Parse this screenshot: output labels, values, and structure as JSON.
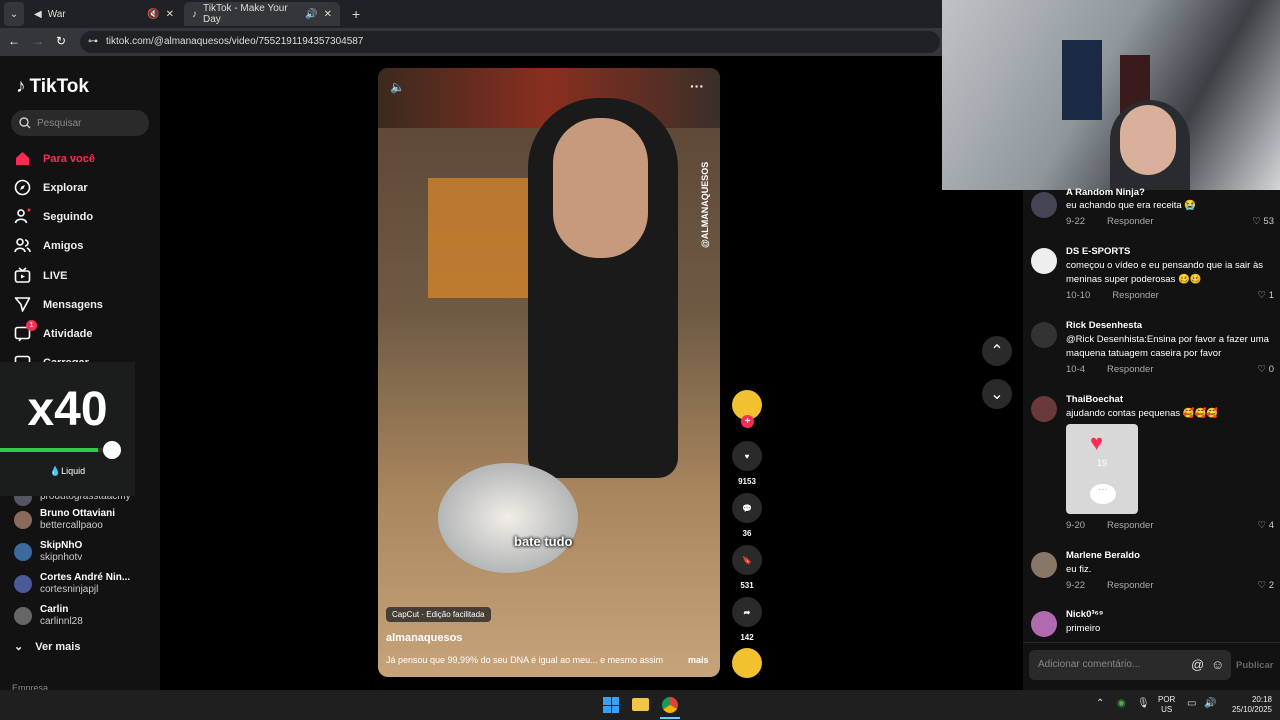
{
  "browser": {
    "tabs": [
      {
        "title": "War",
        "active": false
      },
      {
        "title": "TikTok - Make Your Day",
        "active": true
      }
    ],
    "url": "tiktok.com/@almanaquesos/video/7552191194357304587"
  },
  "sidebar": {
    "logo": "TikTok",
    "search_placeholder": "Pesquisar",
    "nav": [
      {
        "label": "Para você",
        "icon": "home-icon",
        "active": true
      },
      {
        "label": "Explorar",
        "icon": "compass-icon"
      },
      {
        "label": "Seguindo",
        "icon": "following-icon"
      },
      {
        "label": "Amigos",
        "icon": "friends-icon"
      },
      {
        "label": "LIVE",
        "icon": "live-icon"
      },
      {
        "label": "Mensagens",
        "icon": "send-icon"
      },
      {
        "label": "Atividade",
        "icon": "activity-icon",
        "badge": "1"
      },
      {
        "label": "Carregar",
        "icon": "upload-icon"
      }
    ],
    "following": [
      {
        "name": "",
        "handle": "produtograsstaacmy"
      },
      {
        "name": "Bruno Ottaviani",
        "handle": "bettercallpaoo"
      },
      {
        "name": "SkipNhO",
        "handle": "skipnhotv"
      },
      {
        "name": "Cortes André Nin...",
        "handle": "cortesninjapjl"
      },
      {
        "name": "Carlin",
        "handle": "carlinnl28"
      }
    ],
    "see_more": "Ver mais",
    "footer": "Empresa"
  },
  "overlay": {
    "multiplier": "x40",
    "brand": "Liquid",
    "level": 0.82
  },
  "video": {
    "watermark": "@ALMANAQUESOS",
    "caption": "bate tudo",
    "capcut": "CapCut · Edição facilitada",
    "author": "almanaquesos",
    "description": "Já pensou que 99,99% do seu DNA é igual ao meu... e mesmo assim",
    "more": "mais",
    "actions": {
      "likes": "9153",
      "comments": "36",
      "saves": "531",
      "shares": "142"
    }
  },
  "comments": [
    {
      "user": "A Random Ninja?",
      "text": "eu achando que era receita 😭",
      "date": "9-22",
      "likes": "53"
    },
    {
      "user": "DS E-SPORTS",
      "text": "começou o vídeo e eu pensando que ia sair às meninas super poderosas 🥴🥴",
      "date": "10-10",
      "likes": "1"
    },
    {
      "user": "Rick Desenhesta",
      "text": "@Rick Desenhista:Ensina por favor a fazer uma maquena tatuagem caseira por favor",
      "date": "10-4",
      "likes": "0"
    },
    {
      "user": "ThaiBoechat",
      "text": "ajudando contas pequenas 🥰🥰🥰",
      "date": "9-20",
      "likes": "4",
      "sticker_count": "19"
    },
    {
      "user": "Marlene Beraldo",
      "text": "eu fiz.",
      "date": "9-22",
      "likes": "2"
    },
    {
      "user": "Nick0³⁶⁹",
      "text": "primeiro",
      "date": "",
      "likes": ""
    }
  ],
  "reply_label": "Responder",
  "comment_input_placeholder": "Adicionar comentário...",
  "publish_label": "Publicar",
  "taskbar": {
    "lang1": "POR",
    "lang2": "US",
    "time": "20:18",
    "date": "25/10/2025"
  }
}
